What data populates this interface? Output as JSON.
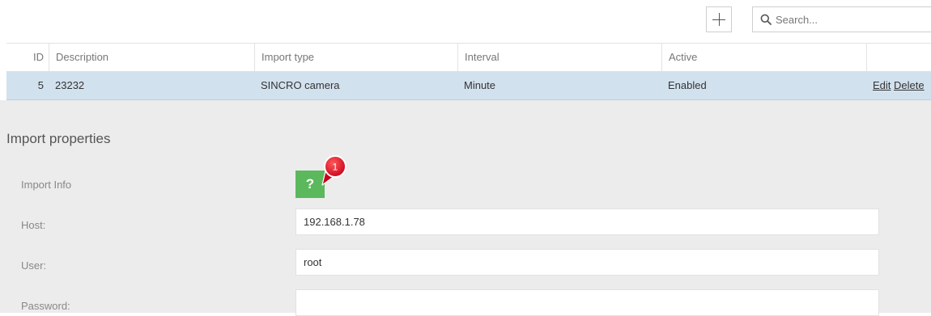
{
  "toolbar": {
    "add_icon": "plus-icon",
    "search_icon": "search-icon",
    "search_placeholder": "Search...",
    "search_value": ""
  },
  "grid": {
    "columns": [
      "ID",
      "Description",
      "Import type",
      "Interval",
      "Active",
      ""
    ],
    "rows": [
      {
        "id": "5",
        "description": "23232",
        "import_type": "SINCRO camera",
        "interval": "Minute",
        "active": "Enabled",
        "edit_label": "Edit",
        "delete_label": "Delete",
        "selected": true
      }
    ]
  },
  "properties": {
    "title": "Import properties",
    "import_info_label": "Import Info",
    "help_button_label": "?",
    "help_icon": "question-icon",
    "badge_count": "1",
    "host_label": "Host:",
    "host_value": "192.168.1.78",
    "user_label": "User:",
    "user_value": "root",
    "password_label": "Password:",
    "password_value": ""
  },
  "colors": {
    "selected_row": "#d2e1ee",
    "help_button": "#5cb85c",
    "badge": "#d9001b",
    "properties_bg": "#ececec"
  }
}
